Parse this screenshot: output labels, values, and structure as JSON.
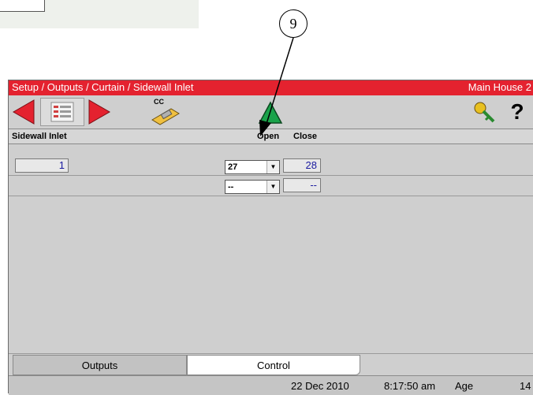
{
  "callout": {
    "number": "9"
  },
  "window": {
    "title": "Setup / Outputs / Curtain / Sidewall Inlet",
    "house": "Main House 2"
  },
  "toolbar": {
    "cc_label": "CC",
    "help_label": "?",
    "icons": [
      "arrow-left-icon",
      "list-icon",
      "arrow-right-icon",
      "tool-cc-icon",
      "alert-triangle-icon",
      "key-icon",
      "help-icon"
    ]
  },
  "table": {
    "headers": {
      "name": "Sidewall Inlet",
      "open": "Open",
      "close": "Close"
    },
    "rows": [
      {
        "index": "1",
        "open": "27",
        "close": "28"
      },
      {
        "index": "",
        "open": "--",
        "close": "--"
      }
    ]
  },
  "tabs": {
    "outputs": "Outputs",
    "control": "Control"
  },
  "status": {
    "date": "22 Dec 2010",
    "time": "8:17:50 am",
    "age_label": "Age",
    "age_value": "14"
  },
  "colors": {
    "title_bar": "#e4222f",
    "value_text": "#1a1aa0",
    "arrow_red": "#e4222f",
    "alert_green": "#1aa34a"
  }
}
